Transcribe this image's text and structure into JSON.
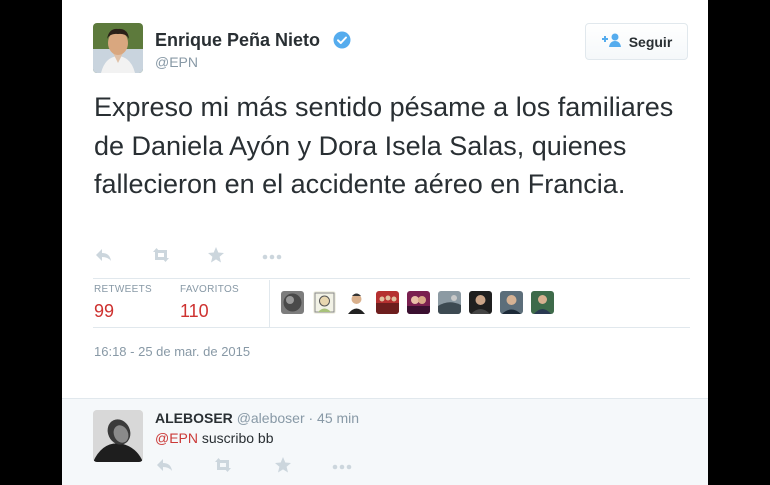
{
  "tweet": {
    "author_name": "Enrique Peña Nieto",
    "author_handle": "@EPN",
    "follow_label": "Seguir",
    "text": "Expreso mi más sentido pésame a los familiares de Daniela Ayón y Dora Isela Salas, quienes fallecieron en el accidente aéreo en Francia.",
    "stats": {
      "retweets_label": "RETWEETS",
      "retweets": "99",
      "favorites_label": "FAVORITOS",
      "favorites": "110"
    },
    "timestamp": "16:18 - 25 de mar. de 2015"
  },
  "reply": {
    "author_name": "ALEBOSER",
    "author_handle": "@aleboser",
    "time": "· 45 min",
    "mention": "@EPN",
    "text": " suscribo bb"
  },
  "icons": [
    "verified-badge-icon",
    "follow-person-plus-icon",
    "reply-icon",
    "retweet-icon",
    "favorite-star-icon",
    "more-ellipsis-icon"
  ],
  "colors": {
    "accent": "#55acee",
    "stat_numbers": "#ce3230",
    "mention": "#cb3a38",
    "muted": "#8899a6"
  }
}
